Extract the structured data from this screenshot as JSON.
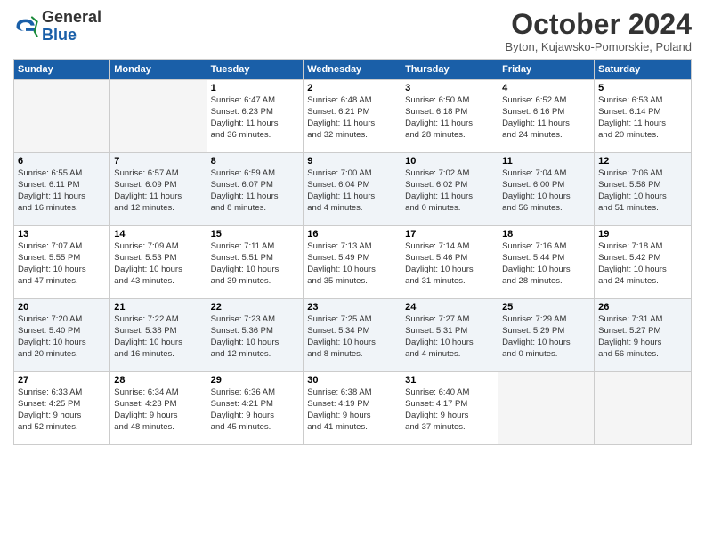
{
  "header": {
    "logo_line1": "General",
    "logo_line2": "Blue",
    "month": "October 2024",
    "location": "Byton, Kujawsko-Pomorskie, Poland"
  },
  "weekdays": [
    "Sunday",
    "Monday",
    "Tuesday",
    "Wednesday",
    "Thursday",
    "Friday",
    "Saturday"
  ],
  "weeks": [
    [
      {
        "day": "",
        "info": ""
      },
      {
        "day": "",
        "info": ""
      },
      {
        "day": "1",
        "info": "Sunrise: 6:47 AM\nSunset: 6:23 PM\nDaylight: 11 hours\nand 36 minutes."
      },
      {
        "day": "2",
        "info": "Sunrise: 6:48 AM\nSunset: 6:21 PM\nDaylight: 11 hours\nand 32 minutes."
      },
      {
        "day": "3",
        "info": "Sunrise: 6:50 AM\nSunset: 6:18 PM\nDaylight: 11 hours\nand 28 minutes."
      },
      {
        "day": "4",
        "info": "Sunrise: 6:52 AM\nSunset: 6:16 PM\nDaylight: 11 hours\nand 24 minutes."
      },
      {
        "day": "5",
        "info": "Sunrise: 6:53 AM\nSunset: 6:14 PM\nDaylight: 11 hours\nand 20 minutes."
      }
    ],
    [
      {
        "day": "6",
        "info": "Sunrise: 6:55 AM\nSunset: 6:11 PM\nDaylight: 11 hours\nand 16 minutes."
      },
      {
        "day": "7",
        "info": "Sunrise: 6:57 AM\nSunset: 6:09 PM\nDaylight: 11 hours\nand 12 minutes."
      },
      {
        "day": "8",
        "info": "Sunrise: 6:59 AM\nSunset: 6:07 PM\nDaylight: 11 hours\nand 8 minutes."
      },
      {
        "day": "9",
        "info": "Sunrise: 7:00 AM\nSunset: 6:04 PM\nDaylight: 11 hours\nand 4 minutes."
      },
      {
        "day": "10",
        "info": "Sunrise: 7:02 AM\nSunset: 6:02 PM\nDaylight: 11 hours\nand 0 minutes."
      },
      {
        "day": "11",
        "info": "Sunrise: 7:04 AM\nSunset: 6:00 PM\nDaylight: 10 hours\nand 56 minutes."
      },
      {
        "day": "12",
        "info": "Sunrise: 7:06 AM\nSunset: 5:58 PM\nDaylight: 10 hours\nand 51 minutes."
      }
    ],
    [
      {
        "day": "13",
        "info": "Sunrise: 7:07 AM\nSunset: 5:55 PM\nDaylight: 10 hours\nand 47 minutes."
      },
      {
        "day": "14",
        "info": "Sunrise: 7:09 AM\nSunset: 5:53 PM\nDaylight: 10 hours\nand 43 minutes."
      },
      {
        "day": "15",
        "info": "Sunrise: 7:11 AM\nSunset: 5:51 PM\nDaylight: 10 hours\nand 39 minutes."
      },
      {
        "day": "16",
        "info": "Sunrise: 7:13 AM\nSunset: 5:49 PM\nDaylight: 10 hours\nand 35 minutes."
      },
      {
        "day": "17",
        "info": "Sunrise: 7:14 AM\nSunset: 5:46 PM\nDaylight: 10 hours\nand 31 minutes."
      },
      {
        "day": "18",
        "info": "Sunrise: 7:16 AM\nSunset: 5:44 PM\nDaylight: 10 hours\nand 28 minutes."
      },
      {
        "day": "19",
        "info": "Sunrise: 7:18 AM\nSunset: 5:42 PM\nDaylight: 10 hours\nand 24 minutes."
      }
    ],
    [
      {
        "day": "20",
        "info": "Sunrise: 7:20 AM\nSunset: 5:40 PM\nDaylight: 10 hours\nand 20 minutes."
      },
      {
        "day": "21",
        "info": "Sunrise: 7:22 AM\nSunset: 5:38 PM\nDaylight: 10 hours\nand 16 minutes."
      },
      {
        "day": "22",
        "info": "Sunrise: 7:23 AM\nSunset: 5:36 PM\nDaylight: 10 hours\nand 12 minutes."
      },
      {
        "day": "23",
        "info": "Sunrise: 7:25 AM\nSunset: 5:34 PM\nDaylight: 10 hours\nand 8 minutes."
      },
      {
        "day": "24",
        "info": "Sunrise: 7:27 AM\nSunset: 5:31 PM\nDaylight: 10 hours\nand 4 minutes."
      },
      {
        "day": "25",
        "info": "Sunrise: 7:29 AM\nSunset: 5:29 PM\nDaylight: 10 hours\nand 0 minutes."
      },
      {
        "day": "26",
        "info": "Sunrise: 7:31 AM\nSunset: 5:27 PM\nDaylight: 9 hours\nand 56 minutes."
      }
    ],
    [
      {
        "day": "27",
        "info": "Sunrise: 6:33 AM\nSunset: 4:25 PM\nDaylight: 9 hours\nand 52 minutes."
      },
      {
        "day": "28",
        "info": "Sunrise: 6:34 AM\nSunset: 4:23 PM\nDaylight: 9 hours\nand 48 minutes."
      },
      {
        "day": "29",
        "info": "Sunrise: 6:36 AM\nSunset: 4:21 PM\nDaylight: 9 hours\nand 45 minutes."
      },
      {
        "day": "30",
        "info": "Sunrise: 6:38 AM\nSunset: 4:19 PM\nDaylight: 9 hours\nand 41 minutes."
      },
      {
        "day": "31",
        "info": "Sunrise: 6:40 AM\nSunset: 4:17 PM\nDaylight: 9 hours\nand 37 minutes."
      },
      {
        "day": "",
        "info": ""
      },
      {
        "day": "",
        "info": ""
      }
    ]
  ]
}
